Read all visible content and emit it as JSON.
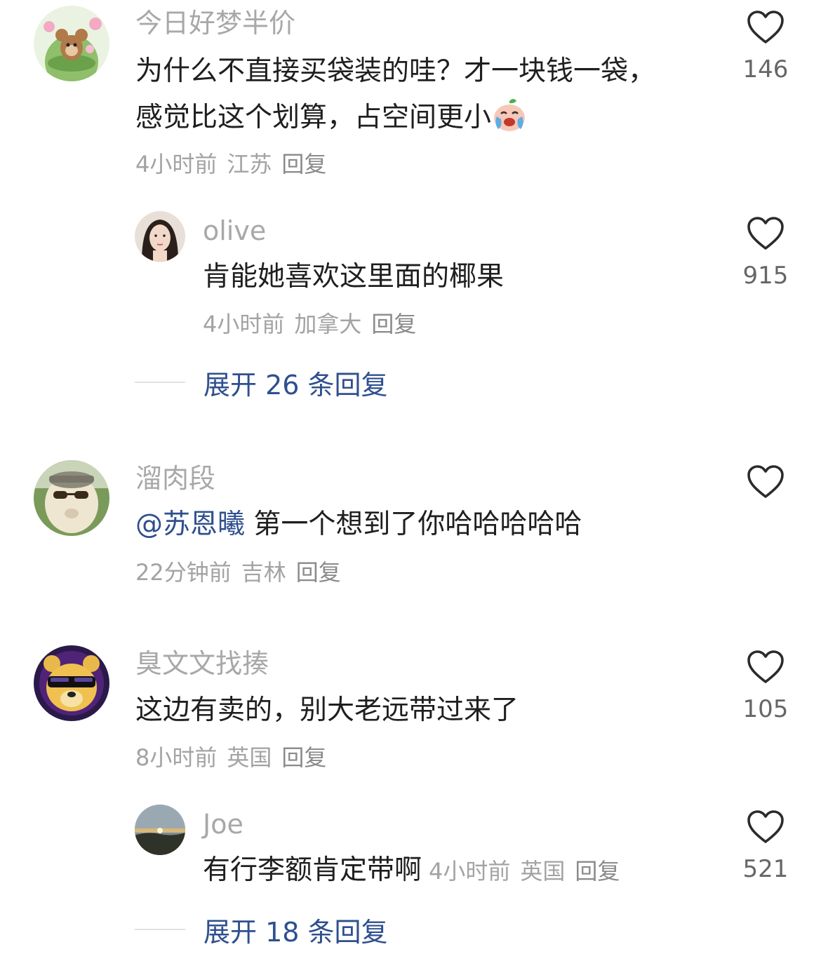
{
  "comments": [
    {
      "username": "今日好梦半价",
      "text_line1": "为什么不直接买袋装的哇？才一块钱一袋，",
      "text_line2": "感觉比这个划算，占空间更小",
      "time": "4小时前",
      "location": "江苏",
      "reply_label": "回复",
      "likes": "146",
      "avatar_icon": "cartoon-mouse-lotus-avatar",
      "emoji_icon": "crying-laughing-emoji-icon",
      "replies": [
        {
          "username": "olive",
          "text": "肯能她喜欢这里面的椰果",
          "time": "4小时前",
          "location": "加拿大",
          "reply_label": "回复",
          "likes": "915",
          "avatar_icon": "woman-portrait-avatar"
        }
      ],
      "expand_label": "展开 26 条回复"
    },
    {
      "username": "溜肉段",
      "mention": "@苏恩曦",
      "text": " 第一个想到了你哈哈哈哈哈",
      "time": "22分钟前",
      "location": "吉林",
      "reply_label": "回复",
      "likes": "",
      "avatar_icon": "alpaca-sunglasses-avatar"
    },
    {
      "username": "臭文文找揍",
      "text": "这边有卖的，别大老远带过来了",
      "time": "8小时前",
      "location": "英国",
      "reply_label": "回复",
      "likes": "105",
      "avatar_icon": "bear-sunglasses-avatar",
      "replies": [
        {
          "username": "Joe",
          "text": "有行李额肯定带啊",
          "time": "4小时前",
          "location": "英国",
          "reply_label": "回复",
          "likes": "521",
          "avatar_icon": "sunset-landscape-avatar"
        }
      ],
      "expand_label": "展开 18 条回复"
    }
  ],
  "colors": {
    "username": "#a8a8a8",
    "text": "#1f1f1f",
    "meta": "#a3a3a3",
    "link": "#2f4f8f",
    "heart_stroke": "#2b2b2b"
  },
  "icons": {
    "like": "heart-outline-icon"
  }
}
